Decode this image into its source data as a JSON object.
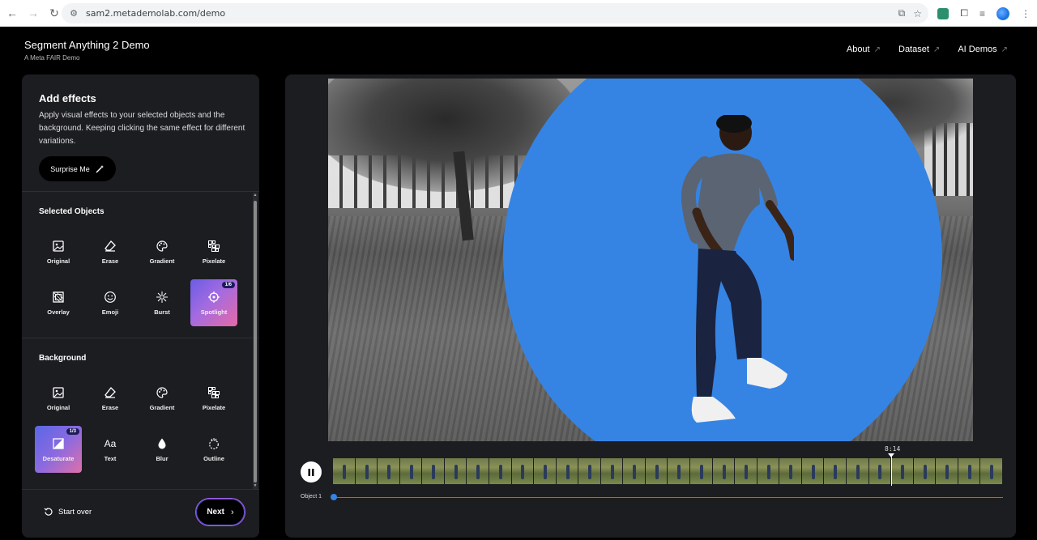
{
  "browser": {
    "url": "sam2.metademolab.com/demo"
  },
  "header": {
    "title": "Segment Anything 2 Demo",
    "subtitle": "A Meta FAIR Demo",
    "nav": [
      {
        "label": "About"
      },
      {
        "label": "Dataset"
      },
      {
        "label": "AI Demos"
      }
    ]
  },
  "effects_panel": {
    "title": "Add effects",
    "description": "Apply visual effects to your selected objects and the background. Keeping clicking the same effect for different variations.",
    "surprise_label": "Surprise Me",
    "selected_objects": {
      "title": "Selected Objects",
      "items": [
        {
          "label": "Original",
          "icon": "image-icon"
        },
        {
          "label": "Erase",
          "icon": "eraser-icon"
        },
        {
          "label": "Gradient",
          "icon": "palette-icon"
        },
        {
          "label": "Pixelate",
          "icon": "pixelate-icon"
        },
        {
          "label": "Overlay",
          "icon": "overlay-icon"
        },
        {
          "label": "Emoji",
          "icon": "emoji-icon"
        },
        {
          "label": "Burst",
          "icon": "burst-icon"
        },
        {
          "label": "Spotlight",
          "icon": "spotlight-icon",
          "active": true,
          "badge": "1/6"
        }
      ]
    },
    "background": {
      "title": "Background",
      "items": [
        {
          "label": "Original",
          "icon": "image-icon"
        },
        {
          "label": "Erase",
          "icon": "eraser-icon"
        },
        {
          "label": "Gradient",
          "icon": "palette-icon"
        },
        {
          "label": "Pixelate",
          "icon": "pixelate-icon"
        },
        {
          "label": "Desaturate",
          "icon": "desaturate-icon",
          "active": true,
          "badge": "1/3"
        },
        {
          "label": "Text",
          "icon": "text-icon",
          "glyph": "Aa"
        },
        {
          "label": "Blur",
          "icon": "drop-icon"
        },
        {
          "label": "Outline",
          "icon": "outline-icon"
        }
      ]
    },
    "start_over_label": "Start over",
    "next_label": "Next"
  },
  "video": {
    "timecode": "8:14",
    "object_label": "Object 1",
    "colors": {
      "spotlight": "#3584e4",
      "track": "#3584e4"
    }
  }
}
